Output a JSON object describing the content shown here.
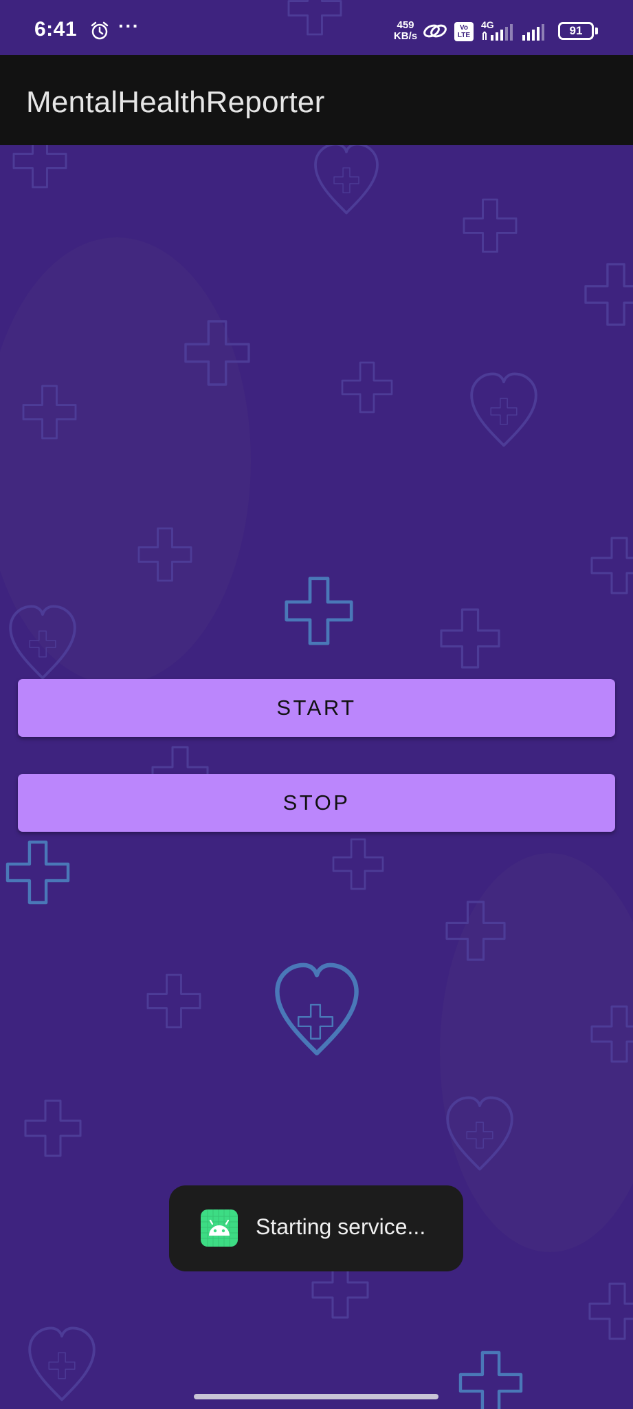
{
  "status_bar": {
    "time": "6:41",
    "more_indicator": "···",
    "network_speed_value": "459",
    "network_speed_unit": "KB/s",
    "volte_line1": "Vo",
    "volte_line2": "LTE",
    "network_type": "4G",
    "battery_level": "91",
    "icons": [
      "alarm-icon",
      "link-icon",
      "volte-icon",
      "signal-icon",
      "signal-icon",
      "battery-icon"
    ]
  },
  "app_bar": {
    "title": "MentalHealthReporter"
  },
  "controls": {
    "start_label": "START",
    "stop_label": "STOP"
  },
  "toast": {
    "message": "Starting service...",
    "icon": "android-icon"
  },
  "colors": {
    "background": "#3e237f",
    "app_bar": "#121212",
    "button": "#bb86fc",
    "pattern_outline": "#4a78b8",
    "toast": "#1c1c1c",
    "toast_icon": "#3ddc84"
  }
}
